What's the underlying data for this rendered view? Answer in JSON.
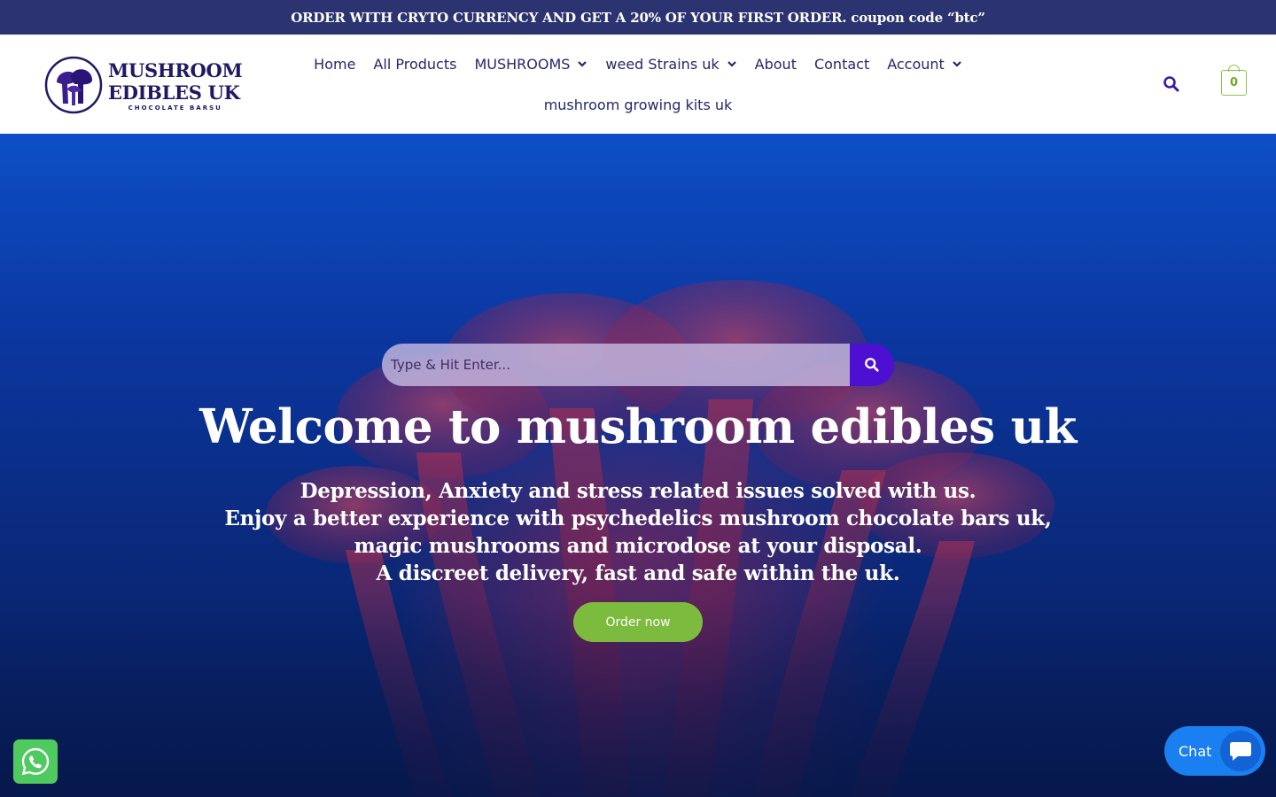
{
  "promo": {
    "text": "ORDER WITH CRYTO CURRENCY AND GET A 20% OF YOUR FIRST ORDER. coupon code “btc”"
  },
  "logo": {
    "line1": "MUSHROOM",
    "line2": "EDIBLES UK",
    "tagline": "CHOCOLATE BARSU"
  },
  "nav": {
    "row1": [
      {
        "label": "Home",
        "has_dropdown": false
      },
      {
        "label": "All Products",
        "has_dropdown": false
      },
      {
        "label": "MUSHROOMS",
        "has_dropdown": true
      },
      {
        "label": "weed Strains uk",
        "has_dropdown": true
      },
      {
        "label": "About",
        "has_dropdown": false
      },
      {
        "label": "Contact",
        "has_dropdown": false
      },
      {
        "label": "Account",
        "has_dropdown": true
      }
    ],
    "row2": [
      {
        "label": "mushroom growing kits uk",
        "has_dropdown": false
      }
    ]
  },
  "header": {
    "search_icon": "search-icon",
    "cart_count": "0"
  },
  "hero": {
    "search_placeholder": "Type & Hit Enter...",
    "title": "Welcome to mushroom edibles uk",
    "lines": [
      "Depression, Anxiety and stress related issues solved with us.",
      "Enjoy a better experience with psychedelics mushroom chocolate bars uk, magic mushrooms and microdose at your disposal.",
      "A discreet delivery, fast and safe within the uk."
    ],
    "cta_label": "Order now"
  },
  "widgets": {
    "whatsapp_icon": "whatsapp-icon",
    "chat_label": "Chat"
  },
  "colors": {
    "promo_bg": "#2b3470",
    "brand_navy": "#1f1863",
    "search_button": "#4d0fd1",
    "cta_green": "#7cbb3e",
    "cart_green": "#8bc34a",
    "whatsapp_green": "#4fca5f",
    "chat_blue": "#1a7ff0"
  }
}
